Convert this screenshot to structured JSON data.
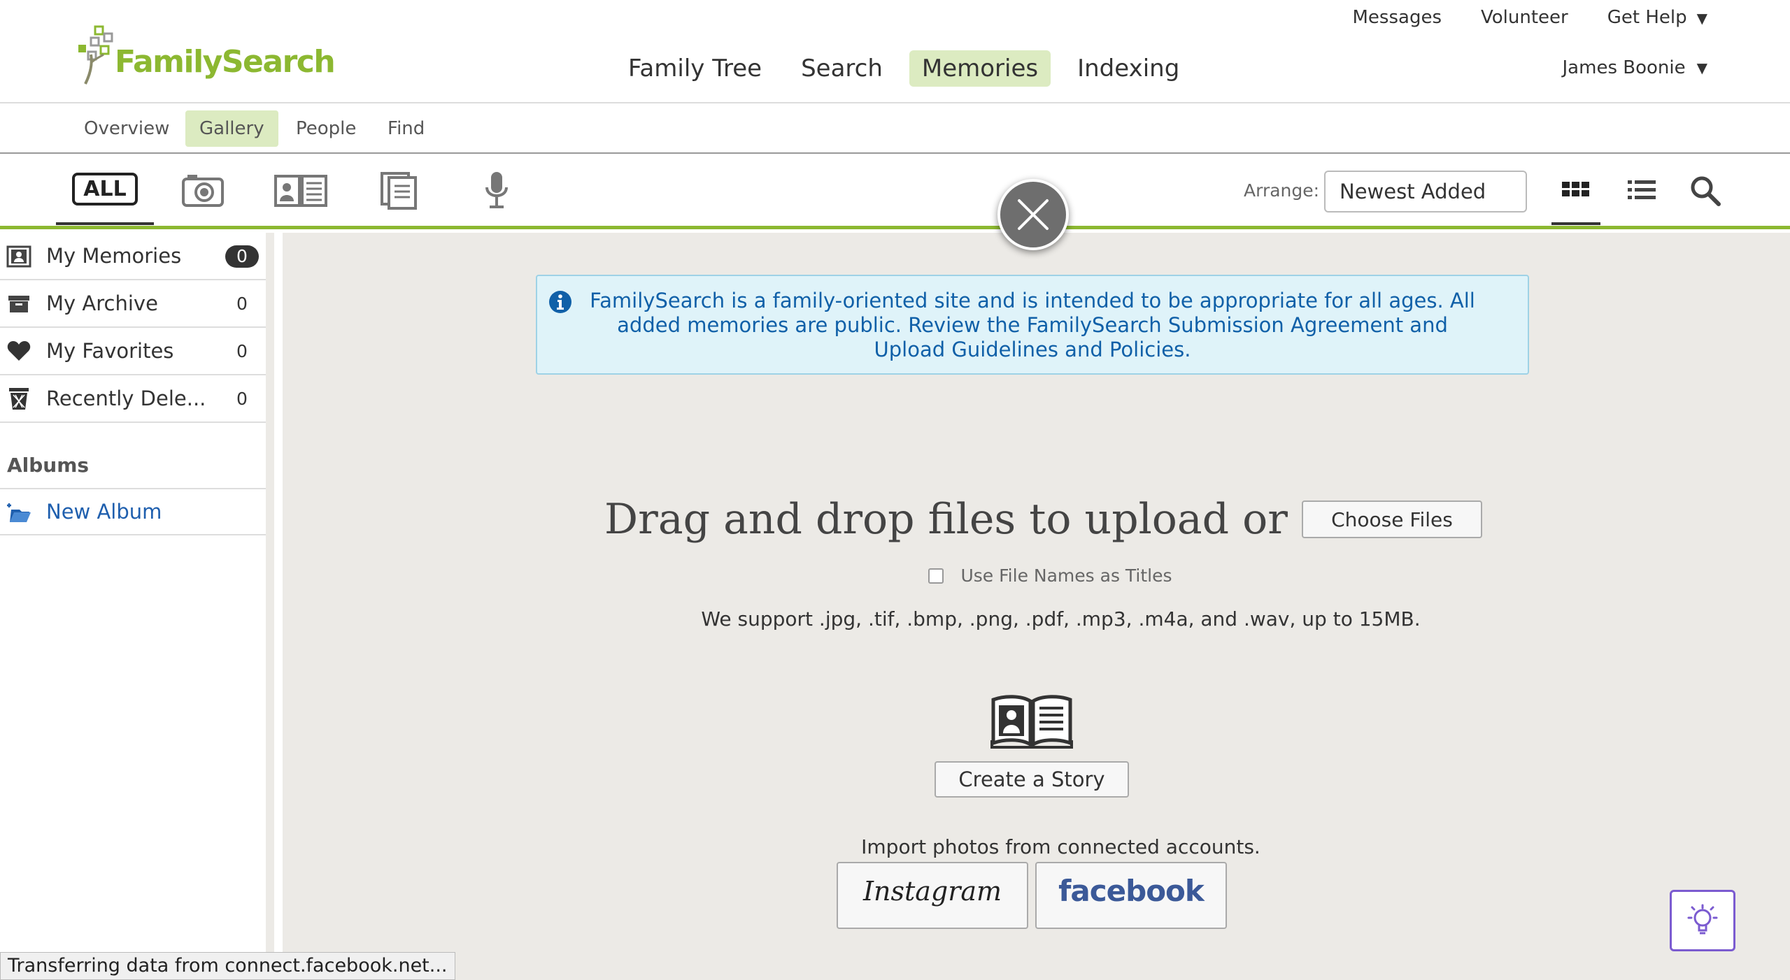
{
  "header": {
    "logo_text": "FamilySearch",
    "top_links": [
      "Messages",
      "Volunteer",
      "Get Help"
    ],
    "caret": "▼",
    "main_nav": [
      "Family Tree",
      "Search",
      "Memories",
      "Indexing"
    ],
    "active_nav": "Memories",
    "user_name": "James Boonie"
  },
  "subnav": {
    "items": [
      "Overview",
      "Gallery",
      "People",
      "Find"
    ],
    "active": "Gallery"
  },
  "toolbar": {
    "filter_tabs": [
      "all",
      "photos-icon",
      "stories-icon",
      "documents-icon",
      "audio-icon"
    ],
    "all_label": "ALL",
    "arrange_label": "Arrange:",
    "arrange_value": "Newest Added",
    "view_modes": [
      "grid-view-icon",
      "list-view-icon",
      "search-icon"
    ]
  },
  "sidebar": {
    "items": [
      {
        "label": "My Memories",
        "count": "0"
      },
      {
        "label": "My Archive",
        "count": "0"
      },
      {
        "label": "My Favorites",
        "count": "0"
      },
      {
        "label": "Recently Dele...",
        "count": "0"
      }
    ],
    "albums_heading": "Albums",
    "new_album_label": "New Album"
  },
  "main": {
    "info_message": "FamilySearch is a family-oriented site and is intended to be appropriate for all ages. All added memories are public. Review the FamilySearch Submission Agreement and Upload Guidelines and Policies.",
    "drag_text": "Drag and drop files to upload or",
    "choose_files_label": "Choose Files",
    "use_filenames_label": "Use File Names as Titles",
    "support_text": "We support .jpg, .tif, .bmp, .png, .pdf, .mp3, .m4a, and .wav, up to 15MB.",
    "create_story_label": "Create a Story",
    "import_text": "Import photos from connected accounts.",
    "instagram_label": "Instagram",
    "facebook_label": "facebook"
  },
  "status_bar": "Transferring data from connect.facebook.net...",
  "colors": {
    "brand_green": "#8cb831",
    "active_tab_bg": "#dcebc1",
    "info_bg": "#dff3f9",
    "info_text": "#1060a8",
    "link_blue": "#1f5fae",
    "facebook_blue": "#3b5998",
    "tip_purple": "#7b5bd0"
  }
}
